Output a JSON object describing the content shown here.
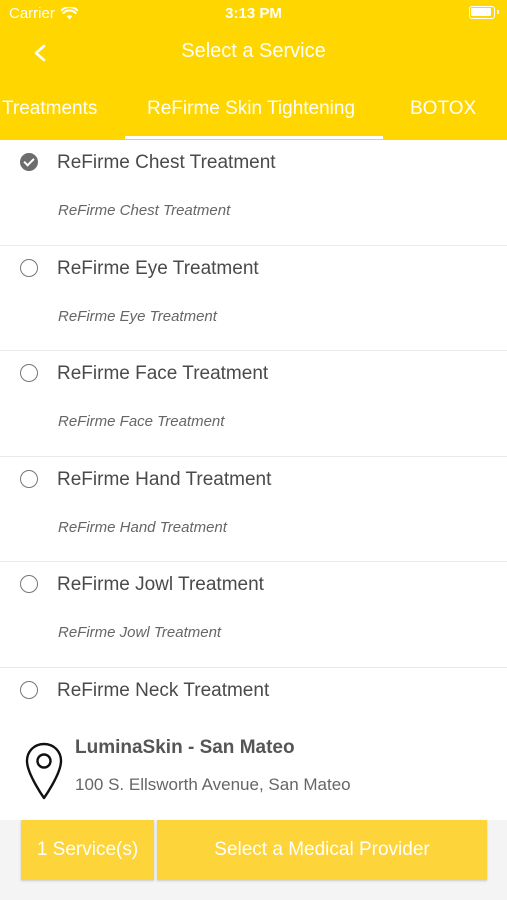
{
  "status_bar": {
    "carrier": "Carrier",
    "time": "3:13 PM"
  },
  "nav": {
    "title": "Select a Service"
  },
  "tabs": [
    {
      "label": "Treatments"
    },
    {
      "label": "ReFirme Skin Tightening",
      "selected": true
    },
    {
      "label": "BOTOX"
    }
  ],
  "services": [
    {
      "title": "ReFirme Chest Treatment",
      "description": "ReFirme Chest Treatment",
      "selected": true
    },
    {
      "title": "ReFirme Eye Treatment",
      "description": "ReFirme Eye Treatment",
      "selected": false
    },
    {
      "title": "ReFirme Face Treatment",
      "description": "ReFirme Face Treatment",
      "selected": false
    },
    {
      "title": "ReFirme Hand Treatment",
      "description": "ReFirme Hand Treatment",
      "selected": false
    },
    {
      "title": "ReFirme Jowl Treatment",
      "description": "ReFirme Jowl Treatment",
      "selected": false
    },
    {
      "title": "ReFirme Neck Treatment",
      "description": "",
      "selected": false
    }
  ],
  "location": {
    "name": "LuminaSkin - San Mateo",
    "address": "100 S. Ellsworth Avenue, San Mateo"
  },
  "footer": {
    "services_button": "1 Service(s)",
    "provider_button": "Select a Medical Provider"
  },
  "colors": {
    "accent": "#FFD600",
    "button": "#FDD43A"
  },
  "icons": [
    "wifi-icon",
    "battery-icon",
    "back-chevron-icon",
    "radio-checked-icon",
    "radio-unchecked-icon",
    "location-pin-icon"
  ]
}
